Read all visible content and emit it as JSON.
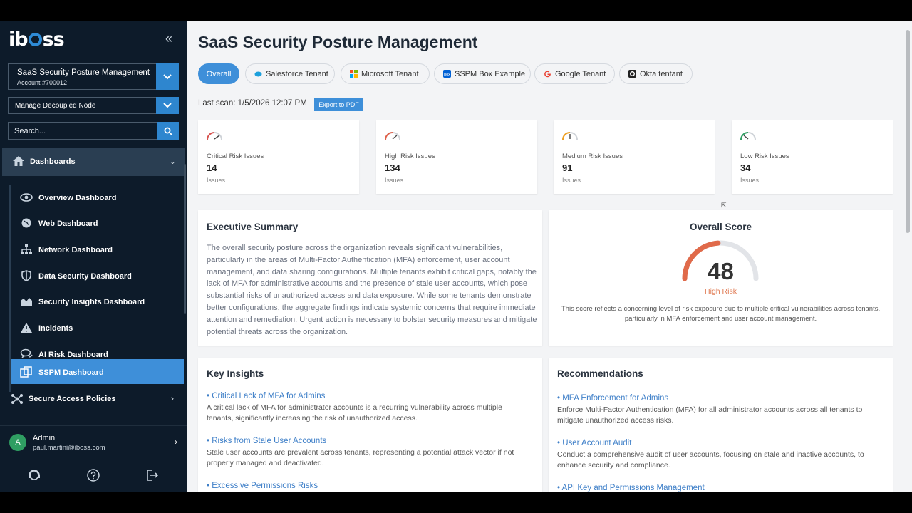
{
  "sidebar": {
    "logo": "iboss",
    "account_select": {
      "name": "SaaS Security Posture Management",
      "account": "Account #700012"
    },
    "node_select": "Manage Decoupled Node",
    "search_placeholder": "Search...",
    "section": "Dashboards",
    "items": [
      {
        "label": "Overview Dashboard",
        "icon": "eye-icon"
      },
      {
        "label": "Web Dashboard",
        "icon": "globe-icon"
      },
      {
        "label": "Network Dashboard",
        "icon": "network-icon"
      },
      {
        "label": "Data Security Dashboard",
        "icon": "shield-icon"
      },
      {
        "label": "Security Insights Dashboard",
        "icon": "area-chart-icon"
      },
      {
        "label": "Incidents",
        "icon": "warning-icon"
      },
      {
        "label": "AI Risk Dashboard",
        "icon": "chat-icon"
      },
      {
        "label": "SSPM Dashboard",
        "icon": "copy-icon"
      }
    ],
    "secure_access": "Secure Access Policies",
    "user": {
      "initial": "A",
      "name": "Admin",
      "email": "paul.martini@iboss.com"
    }
  },
  "main": {
    "title": "SaaS Security Posture Management",
    "tabs": [
      "Overall",
      "Salesforce Tenant",
      "Microsoft Tenant",
      "SSPM Box Example",
      "Google Tenant",
      "Okta tentant"
    ],
    "last_scan": "Last scan: 1/5/2026 12:07 PM",
    "export_label": "Export to PDF",
    "risk_cards": [
      {
        "label": "Critical Risk Issues",
        "value": "14",
        "sub": "Issues",
        "color": "#d9534f"
      },
      {
        "label": "High Risk Issues",
        "value": "134",
        "sub": "Issues",
        "color": "#e0614a"
      },
      {
        "label": "Medium Risk Issues",
        "value": "91",
        "sub": "Issues",
        "color": "#f0a020"
      },
      {
        "label": "Low Risk Issues",
        "value": "34",
        "sub": "Issues",
        "color": "#2f9e62"
      }
    ],
    "exec_summary": {
      "title": "Executive Summary",
      "text": "The overall security posture across the organization reveals significant vulnerabilities, particularly in the areas of Multi-Factor Authentication (MFA) enforcement, user account management, and data sharing configurations. Multiple tenants exhibit critical gaps, notably the lack of MFA for administrative accounts and the presence of stale user accounts, which pose substantial risks of unauthorized access and data exposure. While some tenants demonstrate better configurations, the aggregate findings indicate systemic concerns that require immediate attention and remediation. Urgent action is necessary to bolster security measures and mitigate potential threats across the organization."
    },
    "overall_score": {
      "title": "Overall Score",
      "value": "48",
      "fraction": 0.48,
      "label": "High Risk",
      "desc": "This score reflects a concerning level of risk exposure due to multiple critical vulnerabilities across tenants, particularly in MFA enforcement and user account management."
    },
    "key_insights": {
      "title": "Key Insights",
      "items": [
        {
          "title": "• Critical Lack of MFA for Admins",
          "body": "A critical lack of MFA for administrator accounts is a recurring vulnerability across multiple tenants, significantly increasing the risk of unauthorized access."
        },
        {
          "title": "• Risks from Stale User Accounts",
          "body": "Stale user accounts are prevalent across tenants, representing a potential attack vector if not properly managed and deactivated."
        },
        {
          "title": "• Excessive Permissions Risks",
          "body": ""
        }
      ]
    },
    "recommendations": {
      "title": "Recommendations",
      "items": [
        {
          "title": "• MFA Enforcement for Admins",
          "body": "Enforce Multi-Factor Authentication (MFA) for all administrator accounts across all tenants to mitigate unauthorized access risks."
        },
        {
          "title": "• User Account Audit",
          "body": "Conduct a comprehensive audit of user accounts, focusing on stale and inactive accounts, to enhance security and compliance."
        },
        {
          "title": "• API Key and Permissions Management",
          "body": ""
        }
      ]
    }
  }
}
